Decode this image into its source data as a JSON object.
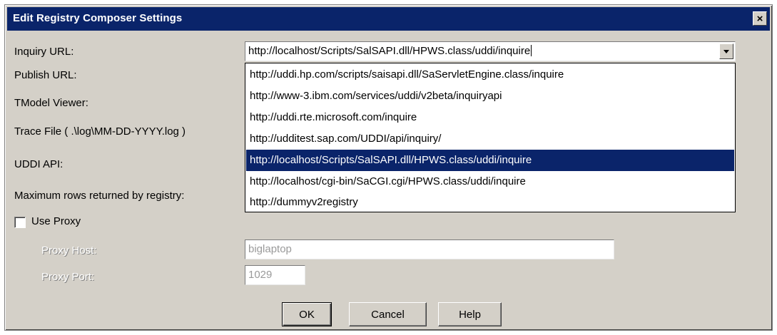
{
  "dialog": {
    "title": "Edit Registry Composer Settings",
    "close_glyph": "×"
  },
  "labels": {
    "inquiry_url": "Inquiry URL:",
    "publish_url": "Publish URL:",
    "tmodel_viewer": "TModel Viewer:",
    "trace_file": "Trace File ( .\\log\\MM-DD-YYYY.log )",
    "uddi_api": "UDDI API:",
    "max_rows": "Maximum rows returned by registry:",
    "use_proxy": "Use Proxy",
    "proxy_host": "Proxy Host:",
    "proxy_port": "Proxy Port:"
  },
  "inquiry_combo": {
    "value": "http://localhost/Scripts/SalSAPI.dll/HPWS.class/uddi/inquire",
    "options": [
      "http://uddi.hp.com/scripts/saisapi.dll/SaServletEngine.class/inquire",
      "http://www-3.ibm.com/services/uddi/v2beta/inquiryapi",
      "http://uddi.rte.microsoft.com/inquire",
      "http://udditest.sap.com/UDDI/api/inquiry/",
      "http://localhost/Scripts/SalSAPI.dll/HPWS.class/uddi/inquire",
      "http://localhost/cgi-bin/SaCGI.cgi/HPWS.class/uddi/inquire",
      "http://dummyv2registry"
    ],
    "selected_index": 4
  },
  "use_proxy_checked": false,
  "proxy": {
    "host": "biglaptop",
    "port": "1029"
  },
  "buttons": {
    "ok": "OK",
    "cancel": "Cancel",
    "help": "Help"
  },
  "colors": {
    "title_bar": "#0a246a",
    "selection": "#0a246a",
    "dialog_bg": "#d4d0c8"
  },
  "icons": {
    "close": "close-icon",
    "dropdown": "chevron-down-icon"
  }
}
